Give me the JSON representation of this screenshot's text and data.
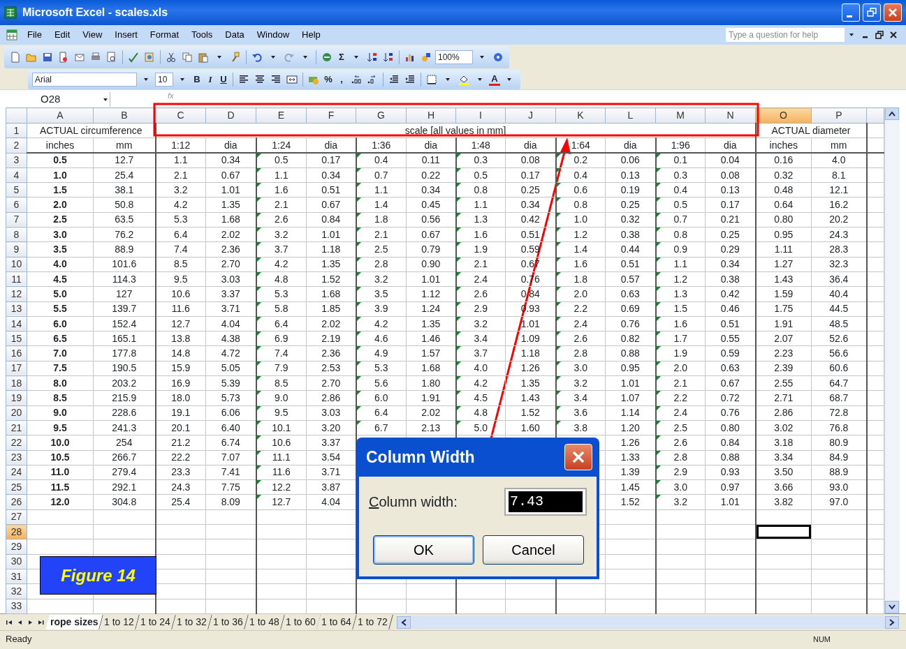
{
  "window": {
    "title": "Microsoft Excel - scales.xls"
  },
  "menu": [
    {
      "label": "File"
    },
    {
      "label": "Edit"
    },
    {
      "label": "View"
    },
    {
      "label": "Insert"
    },
    {
      "label": "Format"
    },
    {
      "label": "Tools"
    },
    {
      "label": "Data"
    },
    {
      "label": "Window"
    },
    {
      "label": "Help"
    }
  ],
  "help_box": {
    "placeholder": "Type a question for help"
  },
  "toolbar": {
    "sum": "Σ",
    "zoom": "100%",
    "font": "Arial",
    "size": "10",
    "bold": "B",
    "italic": "I",
    "underline": "U",
    "percent": "%",
    "comma": ",",
    "font_color": "A"
  },
  "formula_bar": {
    "name_box": "O28",
    "function_label": "fx"
  },
  "columns": [
    {
      "label": "A",
      "bold": true,
      "flagged": false,
      "selected": false
    },
    {
      "label": "B",
      "bold": false,
      "flagged": false,
      "selected": false
    },
    {
      "label": "C",
      "bold": false,
      "flagged": false,
      "selected": false
    },
    {
      "label": "D",
      "bold": false,
      "flagged": false,
      "selected": false
    },
    {
      "label": "E",
      "bold": false,
      "flagged": true,
      "selected": false
    },
    {
      "label": "F",
      "bold": false,
      "flagged": false,
      "selected": false
    },
    {
      "label": "G",
      "bold": false,
      "flagged": true,
      "selected": false
    },
    {
      "label": "H",
      "bold": false,
      "flagged": false,
      "selected": false
    },
    {
      "label": "I",
      "bold": false,
      "flagged": true,
      "selected": false
    },
    {
      "label": "J",
      "bold": false,
      "flagged": false,
      "selected": false
    },
    {
      "label": "K",
      "bold": false,
      "flagged": true,
      "selected": false
    },
    {
      "label": "L",
      "bold": false,
      "flagged": false,
      "selected": false
    },
    {
      "label": "M",
      "bold": false,
      "flagged": true,
      "selected": false
    },
    {
      "label": "N",
      "bold": false,
      "flagged": false,
      "selected": false
    },
    {
      "label": "O",
      "bold": false,
      "flagged": false,
      "selected": true
    },
    {
      "label": "P",
      "bold": false,
      "flagged": false,
      "selected": false
    }
  ],
  "rows": [
    {
      "label": "1",
      "kind": "title",
      "selected": false,
      "groups": [
        {
          "text": "ACTUAL circumference",
          "kind": "pair"
        },
        {
          "text": "scale [all values in mm]",
          "kind": "scales"
        },
        {
          "text": "ACTUAL diameter",
          "kind": "pair"
        }
      ]
    },
    {
      "label": "2",
      "kind": "heading",
      "selected": false,
      "cells": [
        "inches",
        "mm",
        "1:12",
        "dia",
        "1:24",
        "dia",
        "1:36",
        "dia",
        "1:48",
        "dia",
        "1:64",
        "dia",
        "1:96",
        "dia",
        "inches",
        "mm"
      ]
    },
    {
      "label": "3",
      "kind": "data",
      "selected": false,
      "cells": [
        "0.5",
        "12.7",
        "1.1",
        "0.34",
        "0.5",
        "0.17",
        "0.4",
        "0.11",
        "0.3",
        "0.08",
        "0.2",
        "0.06",
        "0.1",
        "0.04",
        "0.16",
        "4.0"
      ]
    },
    {
      "label": "4",
      "kind": "data",
      "selected": false,
      "cells": [
        "1.0",
        "25.4",
        "2.1",
        "0.67",
        "1.1",
        "0.34",
        "0.7",
        "0.22",
        "0.5",
        "0.17",
        "0.4",
        "0.13",
        "0.3",
        "0.08",
        "0.32",
        "8.1"
      ]
    },
    {
      "label": "5",
      "kind": "data",
      "selected": false,
      "cells": [
        "1.5",
        "38.1",
        "3.2",
        "1.01",
        "1.6",
        "0.51",
        "1.1",
        "0.34",
        "0.8",
        "0.25",
        "0.6",
        "0.19",
        "0.4",
        "0.13",
        "0.48",
        "12.1"
      ]
    },
    {
      "label": "6",
      "kind": "data",
      "selected": false,
      "cells": [
        "2.0",
        "50.8",
        "4.2",
        "1.35",
        "2.1",
        "0.67",
        "1.4",
        "0.45",
        "1.1",
        "0.34",
        "0.8",
        "0.25",
        "0.5",
        "0.17",
        "0.64",
        "16.2"
      ]
    },
    {
      "label": "7",
      "kind": "data",
      "selected": false,
      "cells": [
        "2.5",
        "63.5",
        "5.3",
        "1.68",
        "2.6",
        "0.84",
        "1.8",
        "0.56",
        "1.3",
        "0.42",
        "1.0",
        "0.32",
        "0.7",
        "0.21",
        "0.80",
        "20.2"
      ]
    },
    {
      "label": "8",
      "kind": "data",
      "selected": false,
      "cells": [
        "3.0",
        "76.2",
        "6.4",
        "2.02",
        "3.2",
        "1.01",
        "2.1",
        "0.67",
        "1.6",
        "0.51",
        "1.2",
        "0.38",
        "0.8",
        "0.25",
        "0.95",
        "24.3"
      ]
    },
    {
      "label": "9",
      "kind": "data",
      "selected": false,
      "cells": [
        "3.5",
        "88.9",
        "7.4",
        "2.36",
        "3.7",
        "1.18",
        "2.5",
        "0.79",
        "1.9",
        "0.59",
        "1.4",
        "0.44",
        "0.9",
        "0.29",
        "1.11",
        "28.3"
      ]
    },
    {
      "label": "10",
      "kind": "data",
      "selected": false,
      "cells": [
        "4.0",
        "101.6",
        "8.5",
        "2.70",
        "4.2",
        "1.35",
        "2.8",
        "0.90",
        "2.1",
        "0.67",
        "1.6",
        "0.51",
        "1.1",
        "0.34",
        "1.27",
        "32.3"
      ]
    },
    {
      "label": "11",
      "kind": "data",
      "selected": false,
      "cells": [
        "4.5",
        "114.3",
        "9.5",
        "3.03",
        "4.8",
        "1.52",
        "3.2",
        "1.01",
        "2.4",
        "0.76",
        "1.8",
        "0.57",
        "1.2",
        "0.38",
        "1.43",
        "36.4"
      ]
    },
    {
      "label": "12",
      "kind": "data",
      "selected": false,
      "cells": [
        "5.0",
        "127",
        "10.6",
        "3.37",
        "5.3",
        "1.68",
        "3.5",
        "1.12",
        "2.6",
        "0.84",
        "2.0",
        "0.63",
        "1.3",
        "0.42",
        "1.59",
        "40.4"
      ]
    },
    {
      "label": "13",
      "kind": "data",
      "selected": false,
      "cells": [
        "5.5",
        "139.7",
        "11.6",
        "3.71",
        "5.8",
        "1.85",
        "3.9",
        "1.24",
        "2.9",
        "0.93",
        "2.2",
        "0.69",
        "1.5",
        "0.46",
        "1.75",
        "44.5"
      ]
    },
    {
      "label": "14",
      "kind": "data",
      "selected": false,
      "cells": [
        "6.0",
        "152.4",
        "12.7",
        "4.04",
        "6.4",
        "2.02",
        "4.2",
        "1.35",
        "3.2",
        "1.01",
        "2.4",
        "0.76",
        "1.6",
        "0.51",
        "1.91",
        "48.5"
      ]
    },
    {
      "label": "15",
      "kind": "data",
      "selected": false,
      "cells": [
        "6.5",
        "165.1",
        "13.8",
        "4.38",
        "6.9",
        "2.19",
        "4.6",
        "1.46",
        "3.4",
        "1.09",
        "2.6",
        "0.82",
        "1.7",
        "0.55",
        "2.07",
        "52.6"
      ]
    },
    {
      "label": "16",
      "kind": "data",
      "selected": false,
      "cells": [
        "7.0",
        "177.8",
        "14.8",
        "4.72",
        "7.4",
        "2.36",
        "4.9",
        "1.57",
        "3.7",
        "1.18",
        "2.8",
        "0.88",
        "1.9",
        "0.59",
        "2.23",
        "56.6"
      ]
    },
    {
      "label": "17",
      "kind": "data",
      "selected": false,
      "cells": [
        "7.5",
        "190.5",
        "15.9",
        "5.05",
        "7.9",
        "2.53",
        "5.3",
        "1.68",
        "4.0",
        "1.26",
        "3.0",
        "0.95",
        "2.0",
        "0.63",
        "2.39",
        "60.6"
      ]
    },
    {
      "label": "18",
      "kind": "data",
      "selected": false,
      "cells": [
        "8.0",
        "203.2",
        "16.9",
        "5.39",
        "8.5",
        "2.70",
        "5.6",
        "1.80",
        "4.2",
        "1.35",
        "3.2",
        "1.01",
        "2.1",
        "0.67",
        "2.55",
        "64.7"
      ]
    },
    {
      "label": "19",
      "kind": "data",
      "selected": false,
      "cells": [
        "8.5",
        "215.9",
        "18.0",
        "5.73",
        "9.0",
        "2.86",
        "6.0",
        "1.91",
        "4.5",
        "1.43",
        "3.4",
        "1.07",
        "2.2",
        "0.72",
        "2.71",
        "68.7"
      ]
    },
    {
      "label": "20",
      "kind": "data",
      "selected": false,
      "cells": [
        "9.0",
        "228.6",
        "19.1",
        "6.06",
        "9.5",
        "3.03",
        "6.4",
        "2.02",
        "4.8",
        "1.52",
        "3.6",
        "1.14",
        "2.4",
        "0.76",
        "2.86",
        "72.8"
      ]
    },
    {
      "label": "21",
      "kind": "data",
      "selected": false,
      "cells": [
        "9.5",
        "241.3",
        "20.1",
        "6.40",
        "10.1",
        "3.20",
        "6.7",
        "2.13",
        "5.0",
        "1.60",
        "3.8",
        "1.20",
        "2.5",
        "0.80",
        "3.02",
        "76.8"
      ]
    },
    {
      "label": "22",
      "kind": "data",
      "selected": false,
      "cells": [
        "10.0",
        "254",
        "21.2",
        "6.74",
        "10.6",
        "3.37",
        null,
        null,
        null,
        null,
        null,
        "1.26",
        "2.6",
        "0.84",
        "3.18",
        "80.9"
      ]
    },
    {
      "label": "23",
      "kind": "data",
      "selected": false,
      "cells": [
        "10.5",
        "266.7",
        "22.2",
        "7.07",
        "11.1",
        "3.54",
        null,
        null,
        null,
        null,
        null,
        "1.33",
        "2.8",
        "0.88",
        "3.34",
        "84.9"
      ]
    },
    {
      "label": "24",
      "kind": "data",
      "selected": false,
      "cells": [
        "11.0",
        "279.4",
        "23.3",
        "7.41",
        "11.6",
        "3.71",
        null,
        null,
        null,
        null,
        null,
        "1.39",
        "2.9",
        "0.93",
        "3.50",
        "88.9"
      ]
    },
    {
      "label": "25",
      "kind": "data",
      "selected": false,
      "cells": [
        "11.5",
        "292.1",
        "24.3",
        "7.75",
        "12.2",
        "3.87",
        null,
        null,
        null,
        null,
        null,
        "1.45",
        "3.0",
        "0.97",
        "3.66",
        "93.0"
      ]
    },
    {
      "label": "26",
      "kind": "data",
      "selected": false,
      "cells": [
        "12.0",
        "304.8",
        "25.4",
        "8.09",
        "12.7",
        "4.04",
        null,
        null,
        null,
        null,
        null,
        "1.52",
        "3.2",
        "1.01",
        "3.82",
        "97.0"
      ]
    },
    {
      "label": "27",
      "kind": "empty",
      "selected": false
    },
    {
      "label": "28",
      "kind": "empty",
      "selected": true
    },
    {
      "label": "29",
      "kind": "empty",
      "selected": false
    },
    {
      "label": "30",
      "kind": "empty",
      "selected": false
    },
    {
      "label": "31",
      "kind": "empty",
      "selected": false
    },
    {
      "label": "32",
      "kind": "empty",
      "selected": false
    },
    {
      "label": "33",
      "kind": "empty",
      "selected": false
    }
  ],
  "sheet_tabs": [
    {
      "label": "rope sizes",
      "selected": true
    },
    {
      "label": "1 to 12",
      "selected": false
    },
    {
      "label": "1 to 24",
      "selected": false
    },
    {
      "label": "1 to 32",
      "selected": false
    },
    {
      "label": "1 to 36",
      "selected": false
    },
    {
      "label": "1 to 48",
      "selected": false
    },
    {
      "label": "1 to 60",
      "selected": false
    },
    {
      "label": "1 to 64",
      "selected": false
    },
    {
      "label": "1 to 72",
      "selected": false
    }
  ],
  "status_bar": {
    "text": "Ready",
    "num_lock": "NUM"
  },
  "figure_label": "Figure 14",
  "dialog": {
    "title": "Column Width",
    "label_key": "C",
    "label_rest": "olumn width:",
    "field": {
      "value": "7.43",
      "selected": true
    },
    "buttons": [
      {
        "label": "OK",
        "default": true
      },
      {
        "label": "Cancel",
        "default": false
      }
    ]
  }
}
